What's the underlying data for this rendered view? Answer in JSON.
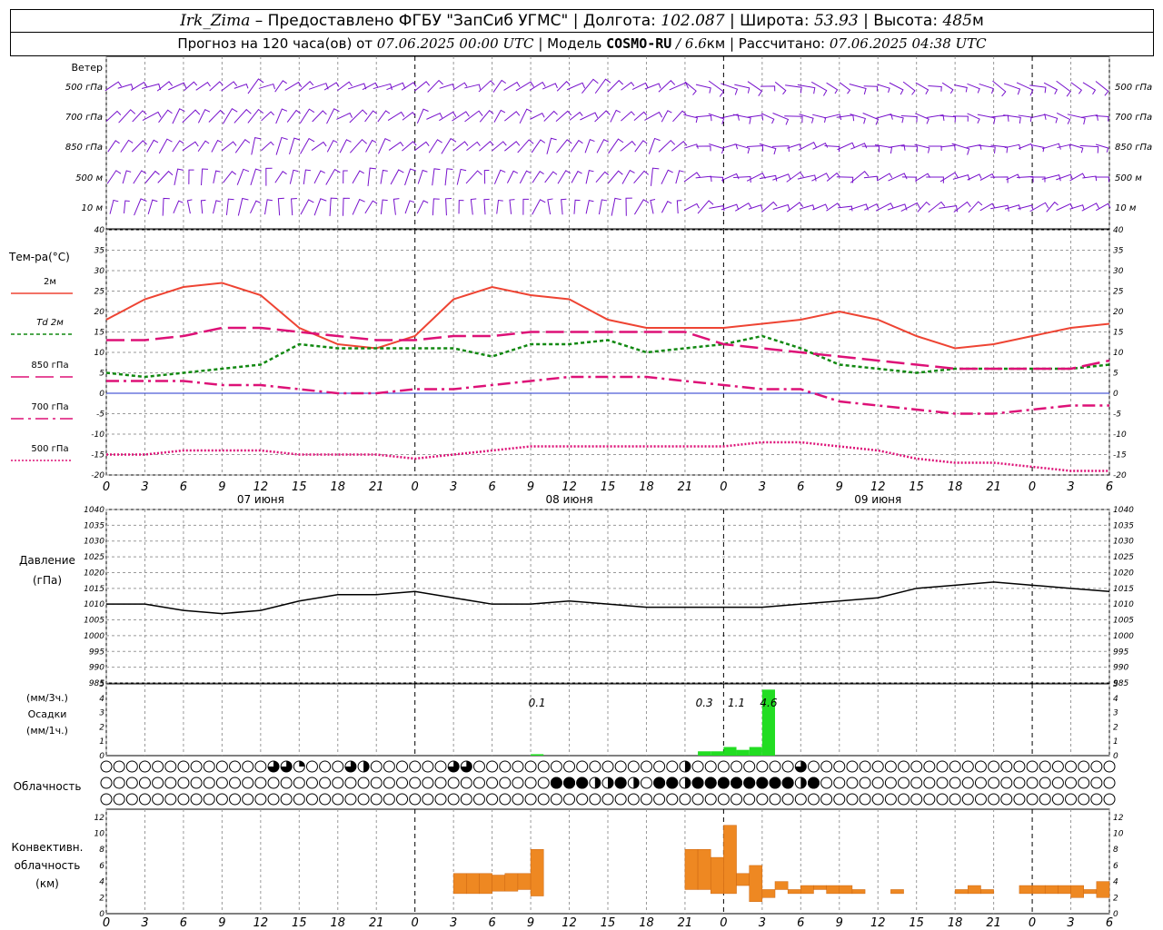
{
  "header": {
    "station": "Irk_Zima",
    "provider": "– Предоставлено ФГБУ \"ЗапСиб УГМС\"",
    "lon_label": "| Долгота:",
    "lon_value": "102.087",
    "lat_label": "| Широта:",
    "lat_value": "53.93",
    "alt_label": "| Высота:",
    "alt_value": "485",
    "alt_unit": "м",
    "forecast_prefix": "Прогноз на 120 часа(ов) от",
    "forecast_start": "07.06.2025 00:00 UTC",
    "model_label": "| Модель",
    "model_name": "COSMO-RU",
    "model_res": "/ 6.6",
    "model_res_unit": "км",
    "calc_label": "| Рассчитано:",
    "calc_time": "07.06.2025 04:38 UTC"
  },
  "colors": {
    "t2m": "#ee4433",
    "td2m": "#118811",
    "t850": "#dd1177",
    "t700": "#dd1177",
    "t500": "#dd1177",
    "zero_line": "#2233cc",
    "wind": "#7711cc",
    "precip": "#22dd22",
    "conv": "#ee8822",
    "pressure": "#000000"
  },
  "chart_data": [
    {
      "type": "wind_barbs",
      "title": "Ветер",
      "levels": [
        "500 гПа",
        "700 гПа",
        "850 гПа",
        "500 м",
        "10 м"
      ]
    },
    {
      "type": "line",
      "ylabel": "Тем-ра(°С)",
      "ylim": [
        -20,
        40
      ],
      "yticks": [
        -20,
        -15,
        -10,
        -5,
        0,
        5,
        10,
        15,
        20,
        25,
        30,
        35,
        40
      ],
      "x_ticks": [
        "0",
        "3",
        "6",
        "9",
        "12",
        "15",
        "18",
        "21",
        "0",
        "3",
        "6",
        "9",
        "12",
        "15",
        "18",
        "21",
        "0",
        "3",
        "6",
        "9",
        "12",
        "15",
        "18",
        "21",
        "0",
        "3",
        "6"
      ],
      "day_labels": [
        "07 июня",
        "08 июня",
        "09 июня"
      ],
      "x": [
        0,
        3,
        6,
        9,
        12,
        15,
        18,
        21,
        24,
        27,
        30,
        33,
        36,
        39,
        42,
        45,
        48,
        51,
        54,
        57,
        60,
        63,
        66,
        69,
        72,
        75,
        78
      ],
      "series": [
        {
          "name": "2м",
          "key": "t2m",
          "dash": "",
          "values": [
            18,
            23,
            26,
            27,
            24,
            16,
            12,
            11,
            14,
            23,
            26,
            24,
            23,
            18,
            16,
            16,
            16,
            17,
            18,
            20,
            18,
            14,
            11,
            12,
            14,
            16,
            17
          ]
        },
        {
          "name": "Td 2м",
          "key": "td2m",
          "dash": "4,3",
          "values": [
            5,
            4,
            5,
            6,
            7,
            12,
            11,
            11,
            11,
            11,
            9,
            12,
            12,
            13,
            10,
            11,
            12,
            14,
            11,
            7,
            6,
            5,
            6,
            6,
            6,
            6,
            7
          ]
        },
        {
          "name": "850 гПа",
          "key": "t850",
          "dash": "20,7",
          "values": [
            13,
            13,
            14,
            16,
            16,
            15,
            14,
            13,
            13,
            14,
            14,
            15,
            15,
            15,
            15,
            15,
            12,
            11,
            10,
            9,
            8,
            7,
            6,
            6,
            6,
            6,
            8
          ]
        },
        {
          "name": "700 гПа",
          "key": "t700",
          "dash": "14,5,3,5",
          "values": [
            3,
            3,
            3,
            2,
            2,
            1,
            0,
            0,
            1,
            1,
            2,
            3,
            4,
            4,
            4,
            3,
            2,
            1,
            1,
            -2,
            -3,
            -4,
            -5,
            -5,
            -4,
            -3,
            -3
          ]
        },
        {
          "name": "500 гПа",
          "key": "t500",
          "dash": "2,2",
          "values": [
            -15,
            -15,
            -14,
            -14,
            -14,
            -15,
            -15,
            -15,
            -16,
            -15,
            -14,
            -13,
            -13,
            -13,
            -13,
            -13,
            -13,
            -12,
            -12,
            -13,
            -14,
            -16,
            -17,
            -17,
            -18,
            -19,
            -19
          ]
        }
      ]
    },
    {
      "type": "line",
      "ylabel": "Давление",
      "yunit": "(гПа)",
      "ylim": [
        985,
        1040
      ],
      "yticks": [
        985,
        990,
        995,
        1000,
        1005,
        1010,
        1015,
        1020,
        1025,
        1030,
        1035,
        1040
      ],
      "x": [
        0,
        3,
        6,
        9,
        12,
        15,
        18,
        21,
        24,
        27,
        30,
        33,
        36,
        39,
        42,
        45,
        48,
        51,
        54,
        57,
        60,
        63,
        66,
        69,
        72,
        75,
        78
      ],
      "values": [
        1010,
        1010,
        1008,
        1007,
        1008,
        1011,
        1013,
        1013,
        1014,
        1012,
        1010,
        1010,
        1011,
        1010,
        1009,
        1009,
        1009,
        1009,
        1010,
        1011,
        1012,
        1015,
        1016,
        1017,
        1016,
        1015,
        1014
      ]
    },
    {
      "type": "bar",
      "ylabel": "Осадки",
      "yunit_top": "(мм/3ч.)",
      "yunit_bottom": "(мм/1ч.)",
      "ylim": [
        0,
        5
      ],
      "yticks": [
        0,
        1,
        2,
        3,
        4,
        5
      ],
      "bars": [
        {
          "x": 33,
          "value": 0.1
        },
        {
          "x": 46,
          "value": 0.3
        },
        {
          "x": 47,
          "value": 0.3
        },
        {
          "x": 48,
          "value": 0.6
        },
        {
          "x": 49,
          "value": 0.4
        },
        {
          "x": 50,
          "value": 0.6
        },
        {
          "x": 51,
          "value": 4.6
        }
      ],
      "labels": [
        {
          "x": 33.5,
          "text": "0.1"
        },
        {
          "x": 46.5,
          "text": "0.3"
        },
        {
          "x": 49,
          "text": "1.1"
        },
        {
          "x": 51.5,
          "text": "4.6"
        }
      ]
    },
    {
      "type": "cloud_cover",
      "ylabel": "Облачность",
      "rows": [
        "0000000000000336000320000003300000000000000002000000003000000000000000000000000000000000000000000000000000000",
        "0000000000000000000000000000000000044422420442444444442400000000000000000000000000000000000000000000000000000",
        "0000000000000000000000000000000000000000000000000000000000000000000000000000000000000000000000000000000000000"
      ]
    },
    {
      "type": "bar",
      "ylabel": "Конвективн. облачность (км)",
      "ylim": [
        0,
        13
      ],
      "yticks": [
        0,
        2,
        4,
        6,
        8,
        10,
        12
      ],
      "blocks": [
        {
          "x": 27.5,
          "base": 2.5,
          "top": 5
        },
        {
          "x": 28.5,
          "base": 2.5,
          "top": 5
        },
        {
          "x": 29.5,
          "base": 2.5,
          "top": 5
        },
        {
          "x": 30.5,
          "base": 2.8,
          "top": 4.8
        },
        {
          "x": 31.5,
          "base": 2.8,
          "top": 5
        },
        {
          "x": 32.5,
          "base": 3,
          "top": 5
        },
        {
          "x": 33.5,
          "base": 2.2,
          "top": 8
        },
        {
          "x": 45.5,
          "base": 3,
          "top": 8
        },
        {
          "x": 46.5,
          "base": 3,
          "top": 8
        },
        {
          "x": 47.5,
          "base": 2.5,
          "top": 7
        },
        {
          "x": 48.5,
          "base": 2.5,
          "top": 11
        },
        {
          "x": 49.5,
          "base": 3.5,
          "top": 5
        },
        {
          "x": 50.5,
          "base": 1.5,
          "top": 6
        },
        {
          "x": 51.5,
          "base": 2,
          "top": 3
        },
        {
          "x": 52.5,
          "base": 3,
          "top": 4
        },
        {
          "x": 53.5,
          "base": 2.5,
          "top": 3
        },
        {
          "x": 54.5,
          "base": 2.5,
          "top": 3.5
        },
        {
          "x": 55.5,
          "base": 3,
          "top": 3.5
        },
        {
          "x": 56.5,
          "base": 2.5,
          "top": 3.5
        },
        {
          "x": 57.5,
          "base": 2.5,
          "top": 3.5
        },
        {
          "x": 58.5,
          "base": 2.5,
          "top": 3
        },
        {
          "x": 61.5,
          "base": 2.5,
          "top": 3
        },
        {
          "x": 66.5,
          "base": 2.5,
          "top": 3
        },
        {
          "x": 67.5,
          "base": 2.5,
          "top": 3.5
        },
        {
          "x": 68.5,
          "base": 2.5,
          "top": 3
        },
        {
          "x": 71.5,
          "base": 2.5,
          "top": 3.5
        },
        {
          "x": 72.5,
          "base": 2.5,
          "top": 3.5
        },
        {
          "x": 73.5,
          "base": 2.5,
          "top": 3.5
        },
        {
          "x": 74.5,
          "base": 2.5,
          "top": 3.5
        },
        {
          "x": 75.5,
          "base": 2,
          "top": 3.5
        },
        {
          "x": 76.5,
          "base": 2.5,
          "top": 3
        },
        {
          "x": 77.5,
          "base": 2,
          "top": 4
        }
      ]
    }
  ]
}
